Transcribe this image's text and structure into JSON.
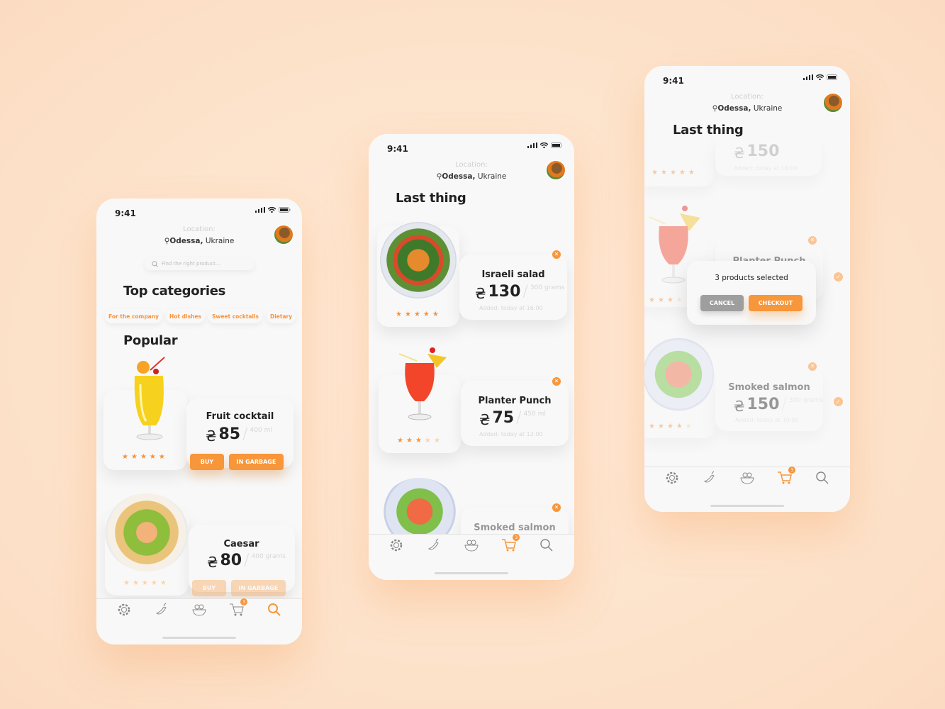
{
  "colors": {
    "background": "#fde3cb",
    "accent": "#f7963a",
    "card": "#f8f8f8",
    "cancel": "#9e9e9e"
  },
  "status": {
    "time": "9:41"
  },
  "location": {
    "label": "Location:",
    "city": "Odessa,",
    "country": "Ukraine"
  },
  "phone1": {
    "search_placeholder": "Find the right product...",
    "categories_title": "Top categories",
    "categories": [
      "For the company",
      "Hot dishes",
      "Sweet cocktails",
      "Dietary"
    ],
    "popular_title": "Popular",
    "products": [
      {
        "name": "Fruit cocktail",
        "currency": "₴",
        "price": "85",
        "unit": "400 ml",
        "rating": 5,
        "buy": "BUY",
        "garbage": "IN GARBAGE"
      },
      {
        "name": "Caesar",
        "currency": "₴",
        "price": "80",
        "unit": "400 grams",
        "rating": 5,
        "buy": "BUY",
        "garbage": "IN GARBAGE"
      }
    ],
    "active_tab": "search"
  },
  "phone2": {
    "title": "Last thing",
    "items": [
      {
        "name": "Israeli salad",
        "currency": "₴",
        "price": "130",
        "unit": "300 grams",
        "added": "Added: today at 16:00",
        "rating": 5
      },
      {
        "name": "Planter Punch",
        "currency": "₴",
        "price": "75",
        "unit": "450 ml",
        "added": "Added: today at 12:00",
        "rating": 3
      },
      {
        "name": "Smoked salmon"
      }
    ],
    "cart_count": "3",
    "active_tab": "cart"
  },
  "phone3": {
    "title": "Last thing",
    "items": [
      {
        "currency": "₴",
        "price": "150",
        "added": "Added: today at 16:00",
        "rating": 5
      },
      {
        "name": "Planter Punch",
        "rating": 3
      },
      {
        "name": "Smoked salmon",
        "currency": "₴",
        "price": "150",
        "unit": "300 grams",
        "added": "Added: today at 10:00",
        "rating": 4
      }
    ],
    "dialog": {
      "message": "3 products selected",
      "cancel": "CANCEL",
      "checkout": "CHECKOUT"
    },
    "cart_count": "3",
    "active_tab": "cart"
  },
  "nav_icons": [
    "gear-icon",
    "chili-icon",
    "salad-bowl-icon",
    "cart-icon",
    "search-icon"
  ]
}
